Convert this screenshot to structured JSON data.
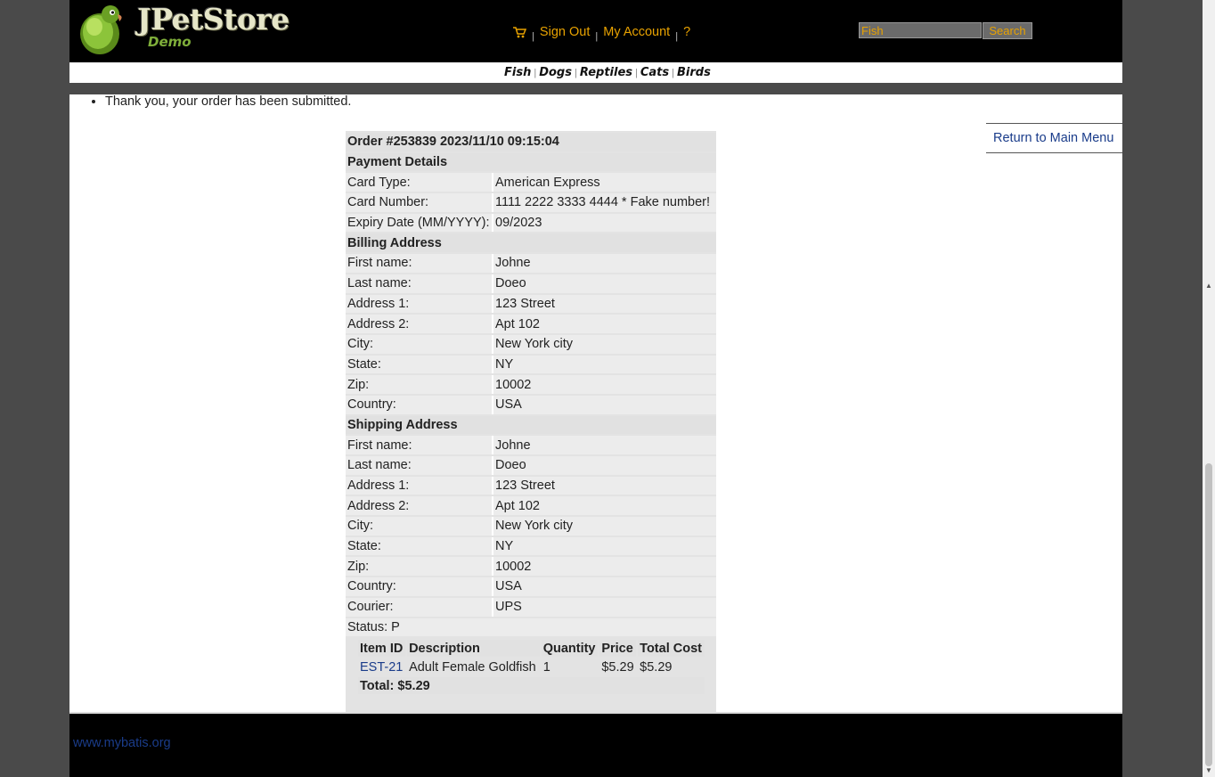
{
  "header": {
    "logo_title": "JPetStore",
    "logo_subtitle": "Demo",
    "cart_icon": "cart-icon",
    "sign_out": "Sign Out",
    "my_account": "My Account",
    "help": "?",
    "separator": "|",
    "search_value": "Fish",
    "search_button": "Search"
  },
  "quicklinks": [
    "Fish",
    "Dogs",
    "Reptiles",
    "Cats",
    "Birds"
  ],
  "messages": [
    "Thank you, your order has been submitted."
  ],
  "return_link": "Return to Main Menu",
  "order": {
    "title": "Order #253839 2023/11/10 09:15:04",
    "payment_header": "Payment Details",
    "payment": [
      {
        "label": "Card Type:",
        "value": "American Express"
      },
      {
        "label": "Card Number:",
        "value": "1111 2222 3333 4444 * Fake number!"
      },
      {
        "label": "Expiry Date (MM/YYYY):",
        "value": "09/2023"
      }
    ],
    "billing_header": "Billing Address",
    "billing": [
      {
        "label": "First name:",
        "value": "Johne"
      },
      {
        "label": "Last name:",
        "value": "Doeo"
      },
      {
        "label": "Address 1:",
        "value": "123 Street"
      },
      {
        "label": "Address 2:",
        "value": "Apt 102"
      },
      {
        "label": "City:",
        "value": "New York city"
      },
      {
        "label": "State:",
        "value": "NY"
      },
      {
        "label": "Zip:",
        "value": "10002"
      },
      {
        "label": "Country:",
        "value": "USA"
      }
    ],
    "shipping_header": "Shipping Address",
    "shipping": [
      {
        "label": "First name:",
        "value": "Johne"
      },
      {
        "label": "Last name:",
        "value": "Doeo"
      },
      {
        "label": "Address 1:",
        "value": "123 Street"
      },
      {
        "label": "Address 2:",
        "value": "Apt 102"
      },
      {
        "label": "City:",
        "value": "New York city"
      },
      {
        "label": "State:",
        "value": "NY"
      },
      {
        "label": "Zip:",
        "value": "10002"
      },
      {
        "label": "Country:",
        "value": "USA"
      },
      {
        "label": "Courier:",
        "value": "UPS"
      }
    ],
    "status": "Status: P",
    "items_columns": [
      "Item ID",
      "Description",
      "Quantity",
      "Price",
      "Total Cost"
    ],
    "items": [
      {
        "item_id": "EST-21",
        "description": "Adult Female Goldfish",
        "quantity": "1",
        "price": "$5.29",
        "total": "$5.29"
      }
    ],
    "total": "Total: $5.29"
  },
  "footer": {
    "link": "www.mybatis.org"
  },
  "colors": {
    "accent": "#e8a200",
    "link": "#1a3c8a",
    "header_bg": "#000000"
  }
}
